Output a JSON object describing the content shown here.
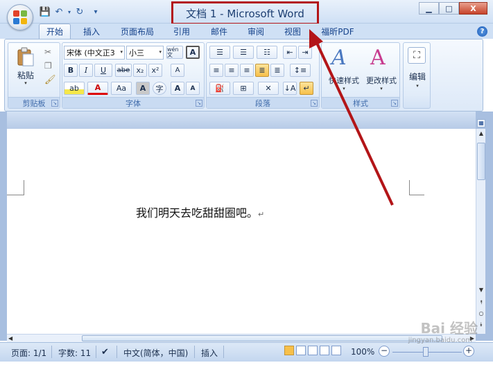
{
  "window": {
    "title": "文档 1 - Microsoft Word",
    "minimize": "▁",
    "maximize": "□",
    "close": "X",
    "help": "?"
  },
  "quick_access": {
    "save": "💾",
    "undo": "↶",
    "redo": "↻",
    "customize": "▾"
  },
  "tabs": [
    "开始",
    "插入",
    "页面布局",
    "引用",
    "邮件",
    "审阅",
    "视图",
    "福昕PDF"
  ],
  "ribbon": {
    "clipboard": {
      "label": "剪贴板",
      "paste": "粘贴"
    },
    "font": {
      "label": "字体",
      "font_name": "宋体 (中文正3",
      "font_size": "小三",
      "bold": "B",
      "italic": "I",
      "underline": "U",
      "strike": "abe",
      "subscript": "x₂",
      "superscript": "x²",
      "grow": "A",
      "shrink": "A",
      "case": "Aa",
      "phonetic": "wén 文",
      "clear": "A",
      "char_border": "A",
      "enclose": "字"
    },
    "paragraph": {
      "label": "段落"
    },
    "styles": {
      "label": "样式",
      "quick_styles": "快速样式",
      "change_styles": "更改样式"
    },
    "editing": {
      "label": "编辑"
    }
  },
  "document": {
    "text": "我们明天去吃甜甜圈吧。",
    "paragraph_mark": "↵"
  },
  "status": {
    "page": "页面: 1/1",
    "words": "字数: 11",
    "language": "中文(简体，中国)",
    "insert_mode": "插入",
    "zoom": "100%"
  },
  "watermark": {
    "brand": "Bai 经验",
    "url": "jingyan.baidu.com"
  },
  "colors": {
    "annotation": "#b31518",
    "ribbon": "#dde9f8",
    "accent": "#15428b"
  }
}
